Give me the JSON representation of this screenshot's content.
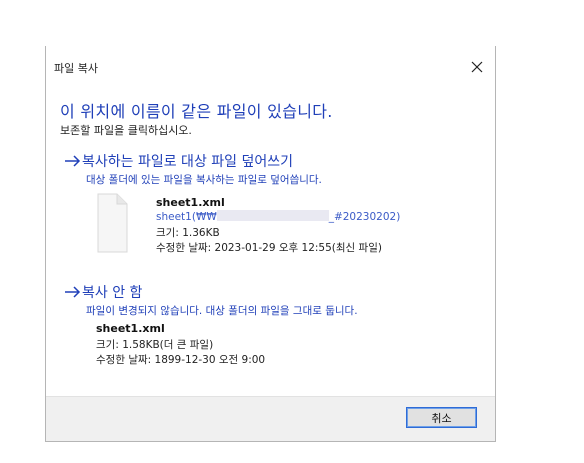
{
  "dialog": {
    "title": "파일 복사",
    "heading": "이 위치에 이름이 같은 파일이 있습니다.",
    "subheading": "보존할 파일을 클릭하십시오."
  },
  "replace_option": {
    "title": "복사하는 파일로 대상 파일 덮어쓰기",
    "description": "대상 폴더에 있는 파일을 복사하는 파일로 덮어씁니다.",
    "file_name": "sheet1.xml",
    "path_start": "sheet1(₩₩",
    "path_end": "_#20230202)",
    "size": "크기: 1.36KB",
    "modified": "수정한 날짜: 2023-01-29 오후 12:55(최신 파일)"
  },
  "skip_option": {
    "title": "복사 안 함",
    "description": "파일이 변경되지 않습니다. 대상 폴더의 파일을 그대로 둡니다.",
    "file_name": "sheet1.xml",
    "size": "크기: 1.58KB(더 큰 파일)",
    "modified": "수정한 날짜: 1899-12-30 오전 9:00"
  },
  "footer": {
    "cancel_label": "취소"
  },
  "colors": {
    "accent": "#1f3fb8",
    "link": "#3b5bc7",
    "footer_bg": "#f0f0f0",
    "button_border": "#2f6bd6"
  },
  "icons": {
    "close": "close-icon",
    "arrow": "arrow-right-icon",
    "file": "file-icon"
  }
}
